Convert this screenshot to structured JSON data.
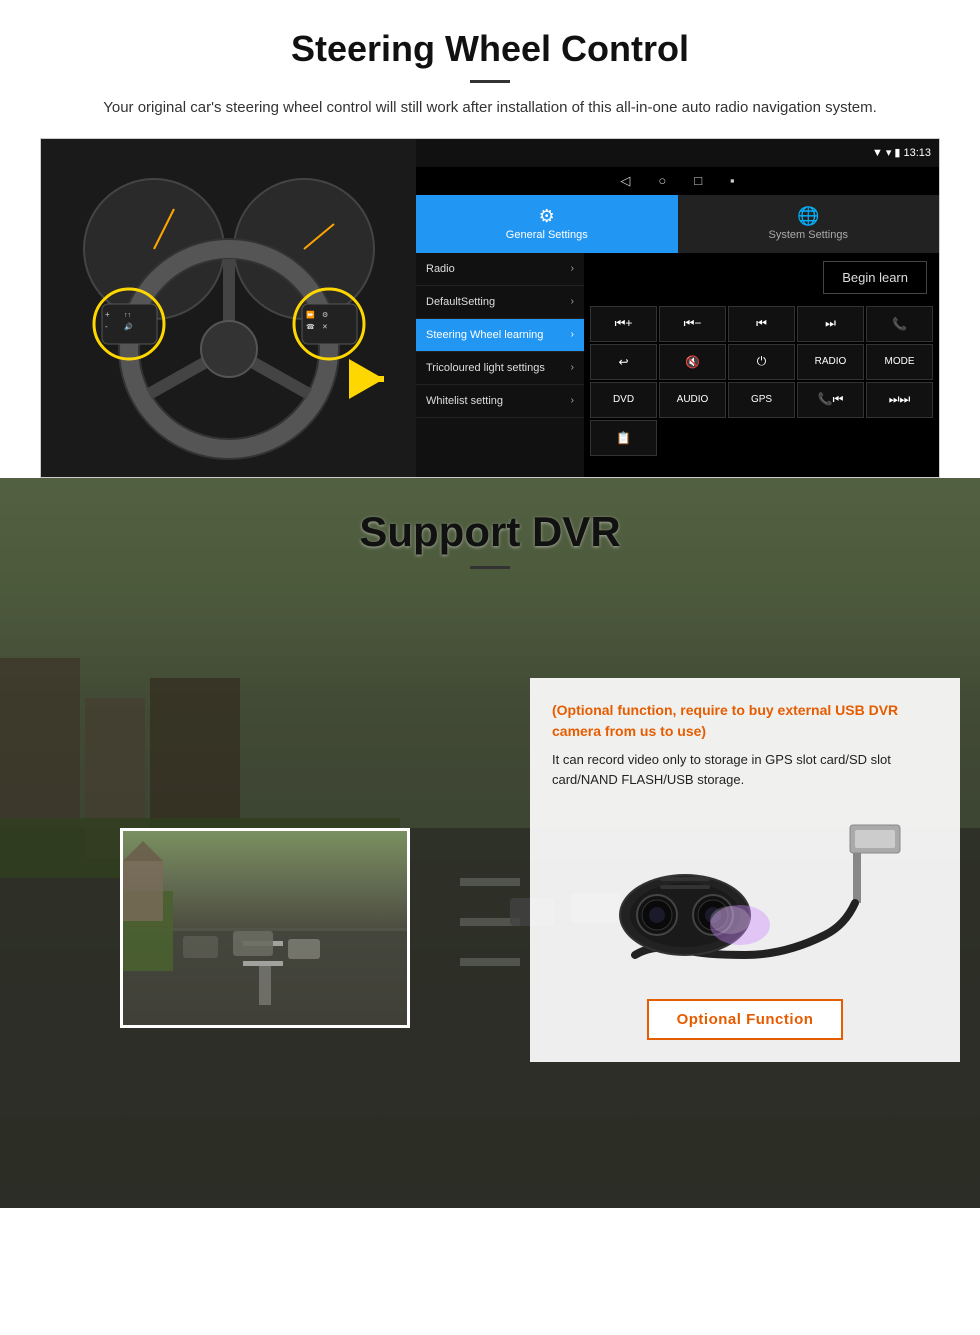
{
  "page": {
    "steering": {
      "title": "Steering Wheel Control",
      "subtitle": "Your original car's steering wheel control will still work after installation of this all-in-one auto radio navigation system.",
      "statusbar": {
        "time": "13:13",
        "signal_icon": "▼",
        "wifi_icon": "▾",
        "battery_icon": "▮"
      },
      "tabs": {
        "general": {
          "label": "General Settings",
          "icon": "⚙"
        },
        "system": {
          "label": "System Settings",
          "icon": "🌐"
        }
      },
      "menu_items": [
        {
          "label": "Radio",
          "active": false
        },
        {
          "label": "DefaultSetting",
          "active": false
        },
        {
          "label": "Steering Wheel learning",
          "active": true
        },
        {
          "label": "Tricoloured light settings",
          "active": false
        },
        {
          "label": "Whitelist setting",
          "active": false
        }
      ],
      "begin_learn_label": "Begin learn",
      "control_buttons": [
        "⏮+",
        "⏮-",
        "⏮",
        "⏭",
        "📞",
        "↩",
        "🔇",
        "⏻",
        "RADIO",
        "MODE",
        "DVD",
        "AUDIO",
        "GPS",
        "📞⏮",
        "⏭⏭",
        "📋"
      ]
    },
    "dvr": {
      "title": "Support DVR",
      "optional_text": "(Optional function, require to buy external USB DVR camera from us to use)",
      "description": "It can record video only to storage in GPS slot card/SD slot card/NAND FLASH/USB storage.",
      "optional_function_btn": "Optional Function"
    }
  }
}
